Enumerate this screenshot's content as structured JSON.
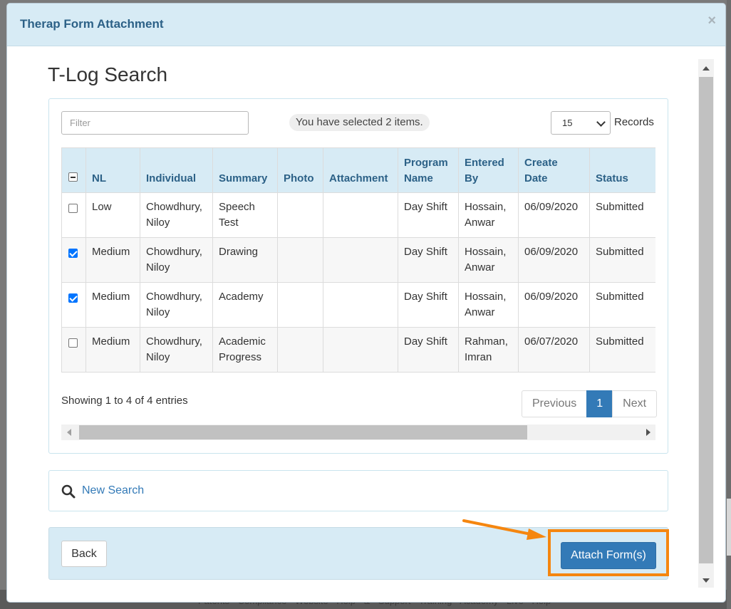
{
  "modal": {
    "title": "Therap Form Attachment",
    "close_label": "×"
  },
  "page": {
    "title": "T-Log Search"
  },
  "toolbar": {
    "filter_placeholder": "Filter",
    "selected_text": "You have selected 2 items.",
    "records_value": "15",
    "records_label": "Records"
  },
  "table": {
    "columns": [
      "NL",
      "Individual",
      "Summary",
      "Photo",
      "Attachment",
      "Program Name",
      "Entered By",
      "Create Date",
      "Status"
    ],
    "rows": [
      {
        "checked": false,
        "nl": "Low",
        "individual": "Chowdhury, Niloy",
        "summary": "Speech Test",
        "photo": "",
        "attachment": "",
        "program": "Day Shift",
        "entered_by": "Hossain, Anwar",
        "create_date": "06/09/2020",
        "status": "Submitted"
      },
      {
        "checked": true,
        "nl": "Medium",
        "individual": "Chowdhury, Niloy",
        "summary": "Drawing",
        "photo": "",
        "attachment": "",
        "program": "Day Shift",
        "entered_by": "Hossain, Anwar",
        "create_date": "06/09/2020",
        "status": "Submitted"
      },
      {
        "checked": true,
        "nl": "Medium",
        "individual": "Chowdhury, Niloy",
        "summary": "Academy",
        "photo": "",
        "attachment": "",
        "program": "Day Shift",
        "entered_by": "Hossain, Anwar",
        "create_date": "06/09/2020",
        "status": "Submitted"
      },
      {
        "checked": false,
        "nl": "Medium",
        "individual": "Chowdhury, Niloy",
        "summary": "Academic Progress",
        "photo": "",
        "attachment": "",
        "program": "Day Shift",
        "entered_by": "Rahman, Imran",
        "create_date": "06/07/2020",
        "status": "Submitted"
      }
    ]
  },
  "pagination": {
    "info": "Showing 1 to 4 of 4 entries",
    "previous": "Previous",
    "current": "1",
    "next": "Next"
  },
  "search": {
    "new_search": "New Search"
  },
  "footer": {
    "back": "Back",
    "attach": "Attach Form(s)"
  },
  "backdrop": {
    "footer_links": "Patents Compliance Website Help & Support Training Academy Live Help"
  },
  "colors": {
    "accent": "#337ab7",
    "header_bg": "#d7ebf5",
    "highlight": "#f5860f"
  }
}
